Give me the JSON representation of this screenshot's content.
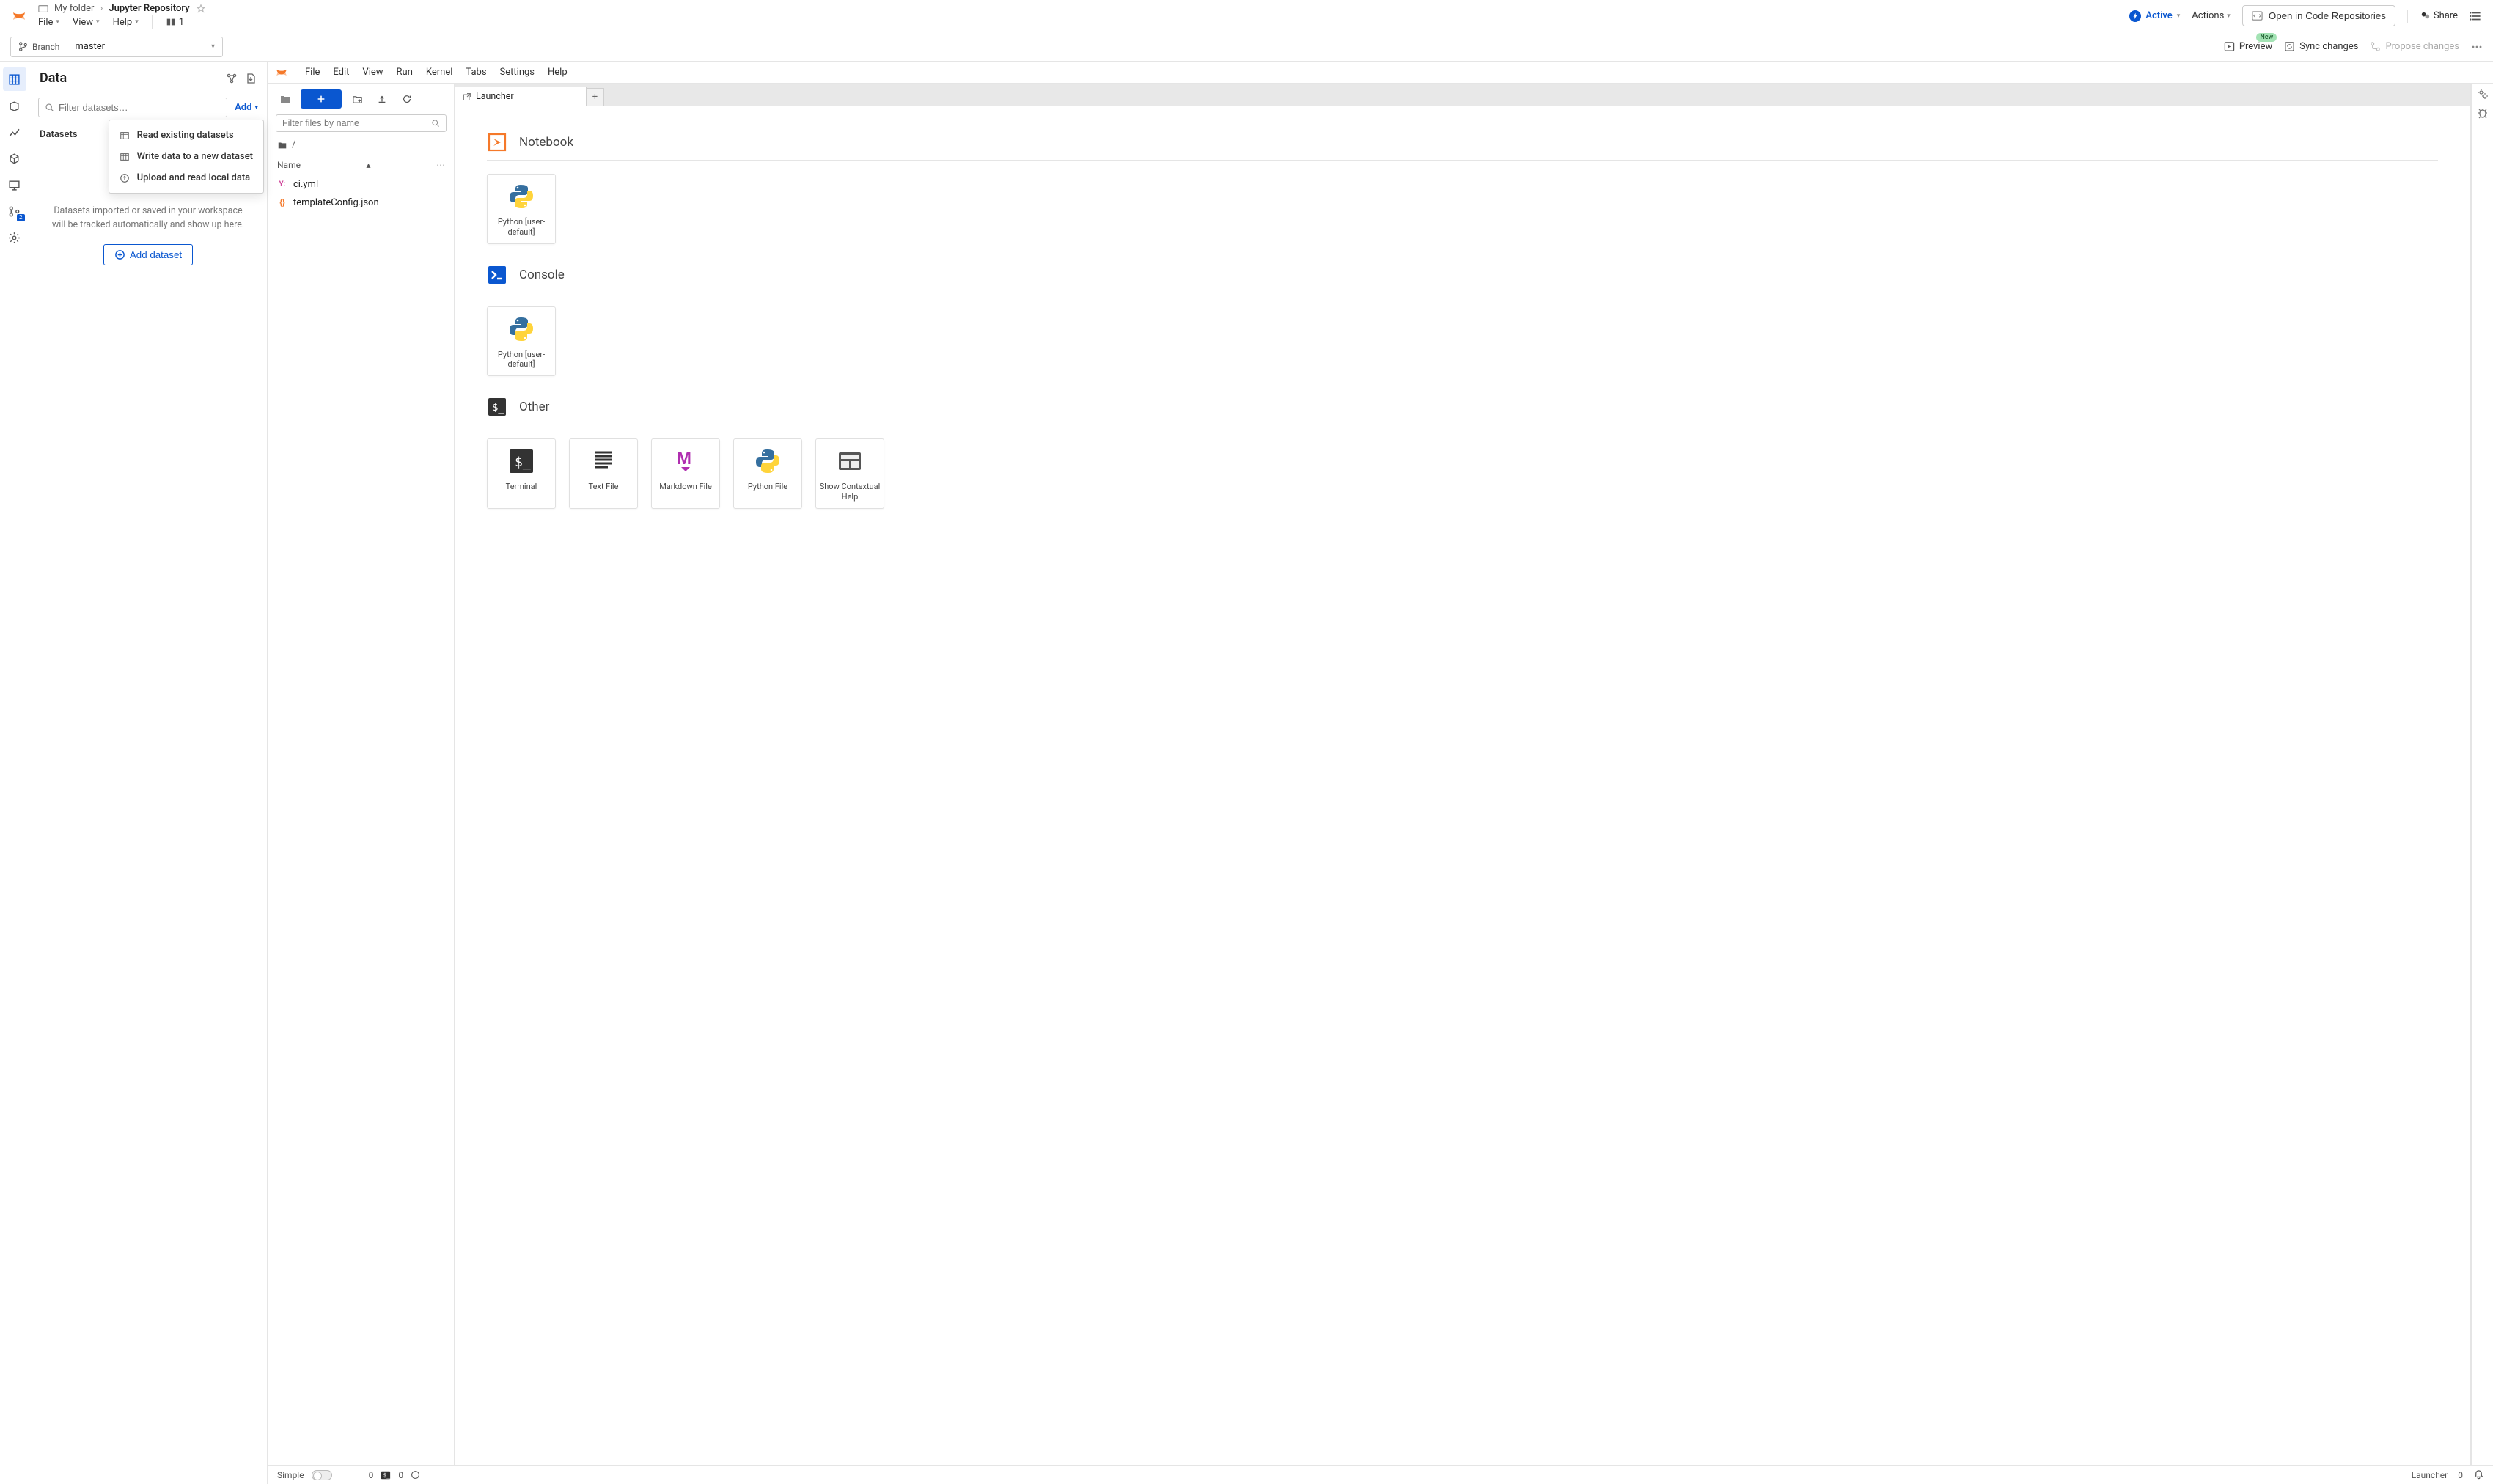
{
  "header": {
    "breadcrumb": {
      "folder": "My folder",
      "title": "Jupyter Repository"
    },
    "file_menu": "File",
    "file_count": "1",
    "view_menu": "View",
    "help_menu": "Help",
    "status": "Active",
    "actions": "Actions",
    "open_in_code": "Open in Code Repositories",
    "share": "Share"
  },
  "subheader": {
    "branch_label": "Branch",
    "branch_value": "master",
    "preview": "Preview",
    "preview_badge": "New",
    "sync": "Sync changes",
    "propose": "Propose changes"
  },
  "data_panel": {
    "title": "Data",
    "filter_placeholder": "Filter datasets…",
    "add": "Add",
    "section": "Datasets",
    "empty_text": "Datasets imported or saved in your workspace will be tracked automatically and show up here.",
    "add_dataset": "Add dataset",
    "menu": {
      "read": "Read existing datasets",
      "write": "Write data to a new dataset",
      "upload": "Upload and read local data"
    }
  },
  "rail": {
    "badge": "2"
  },
  "jupyter": {
    "menus": [
      "File",
      "Edit",
      "View",
      "Run",
      "Kernel",
      "Tabs",
      "Settings",
      "Help"
    ],
    "filter_placeholder": "Filter files by name",
    "crumb_root": "/",
    "col_name": "Name",
    "files": [
      {
        "icon": "yaml",
        "name": "ci.yml"
      },
      {
        "icon": "json",
        "name": "templateConfig.json"
      }
    ],
    "tab": "Launcher",
    "launcher": {
      "notebook": {
        "title": "Notebook",
        "cards": [
          {
            "label": "Python [user-default]",
            "kind": "python"
          }
        ]
      },
      "console": {
        "title": "Console",
        "cards": [
          {
            "label": "Python [user-default]",
            "kind": "python"
          }
        ]
      },
      "other": {
        "title": "Other",
        "cards": [
          {
            "label": "Terminal",
            "kind": "terminal"
          },
          {
            "label": "Text File",
            "kind": "text"
          },
          {
            "label": "Markdown File",
            "kind": "markdown"
          },
          {
            "label": "Python File",
            "kind": "python"
          },
          {
            "label": "Show Contextual Help",
            "kind": "help"
          }
        ]
      }
    },
    "status": {
      "simple": "Simple",
      "term_count": "0",
      "kernel_count": "0",
      "mode": "Launcher",
      "right_count": "0"
    }
  }
}
